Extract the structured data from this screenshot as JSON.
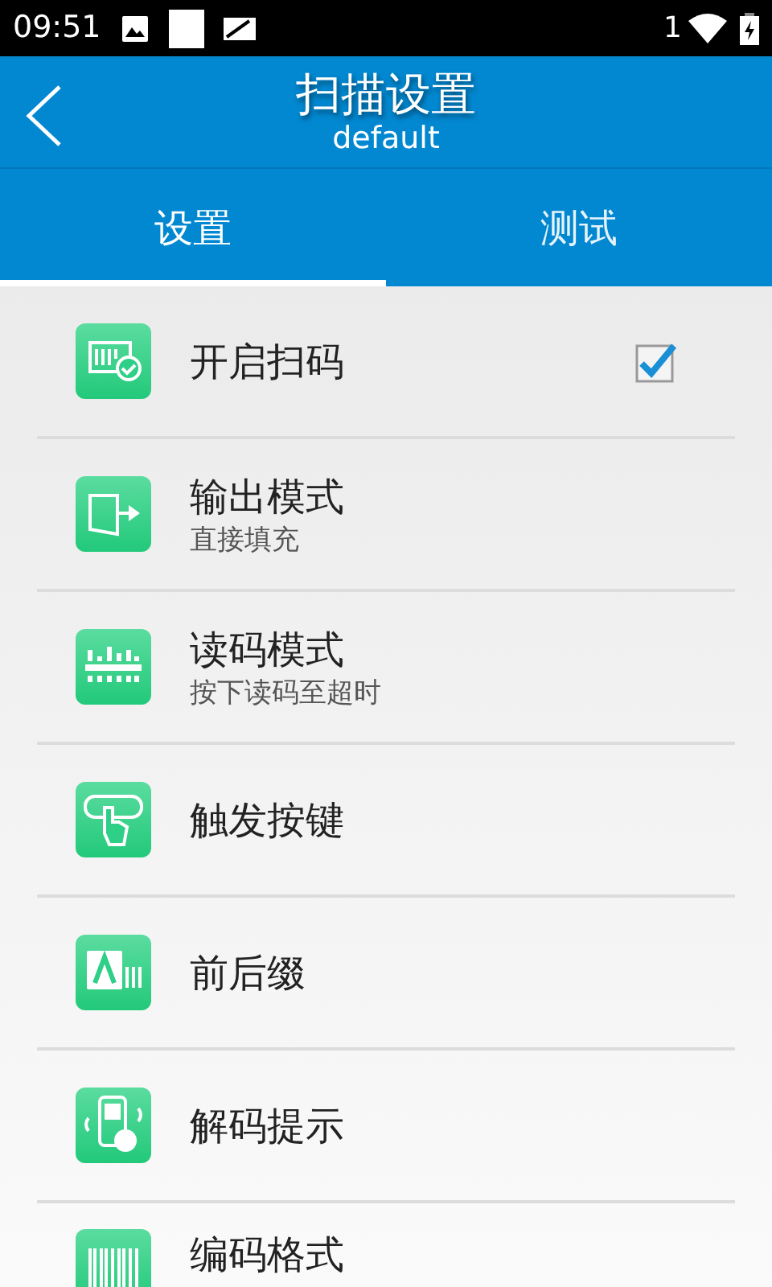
{
  "status_bar": {
    "time": "09:51",
    "sim": "1"
  },
  "header": {
    "title": "扫描设置",
    "subtitle": "default"
  },
  "tabs": [
    {
      "label": "设置",
      "selected": true
    },
    {
      "label": "测试",
      "selected": false
    }
  ],
  "items": [
    {
      "kind": "checkbox",
      "title": "开启扫码",
      "checked": true
    },
    {
      "kind": "plain",
      "title": "输出模式",
      "summary": "直接填充"
    },
    {
      "kind": "plain",
      "title": "读码模式",
      "summary": "按下读码至超时"
    },
    {
      "kind": "plain",
      "title": "触发按键"
    },
    {
      "kind": "plain",
      "title": "前后缀"
    },
    {
      "kind": "plain",
      "title": "解码提示"
    },
    {
      "kind": "plain",
      "title": "编码格式"
    }
  ]
}
